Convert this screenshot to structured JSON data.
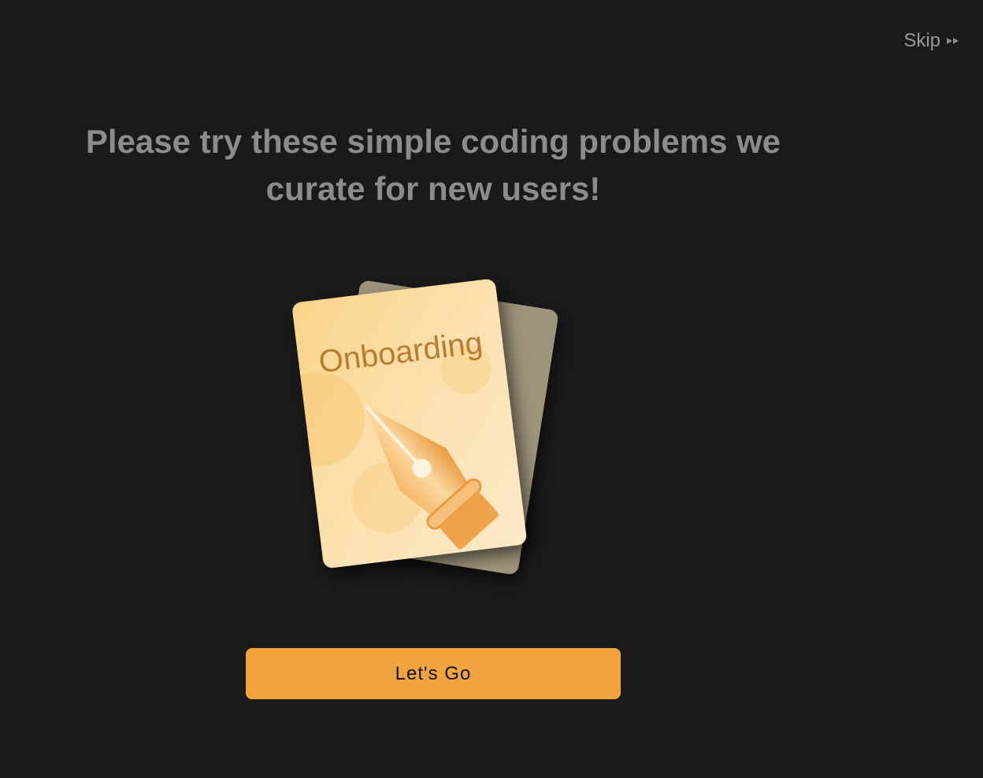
{
  "header": {
    "skip_label": "Skip",
    "skip_icon": "fast-forward-icon"
  },
  "main": {
    "headline_line1": "Please try these simple coding problems we",
    "headline_line2": "curate for new users!",
    "card_label": "Onboarding",
    "card_icon": "fountain-pen-icon",
    "cta_label": "Let's Go"
  },
  "colors": {
    "background": "#1a1a1a",
    "accent": "#f0a33f",
    "headline": "#8c8c8c",
    "card_back": "#9e947a",
    "card_front_light": "#fde8c0",
    "card_text": "#b87a2e"
  }
}
